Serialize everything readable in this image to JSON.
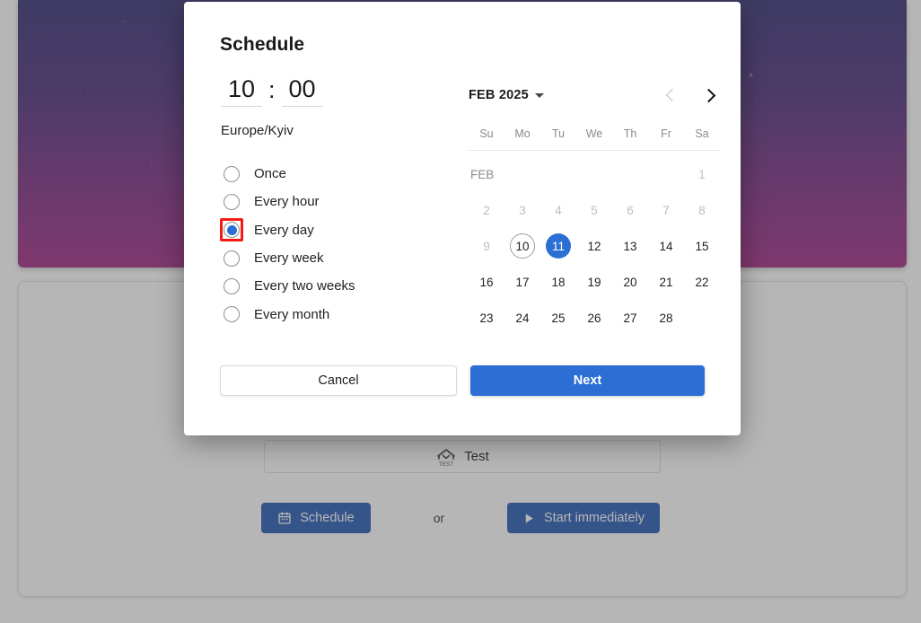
{
  "background": {
    "hero_banner": "starry-purple-gradient-banner",
    "test_strip": {
      "icon": "home-test-icon",
      "icon_caption": "TEST",
      "label": "Test"
    },
    "actions": {
      "schedule_label": "Schedule",
      "schedule_icon": "calendar-icon",
      "or_label": "or",
      "start_label": "Start immediately",
      "start_icon": "play-icon"
    }
  },
  "modal": {
    "title": "Schedule",
    "time": {
      "hours": "10",
      "separator": ":",
      "minutes": "00",
      "hours_placeholder": "HH",
      "minutes_placeholder": "MM"
    },
    "timezone": "Europe/Kyiv",
    "frequency": {
      "selected": "Every day",
      "highlighted": "Every day",
      "options": [
        {
          "label": "Once",
          "checked": false
        },
        {
          "label": "Every hour",
          "checked": false
        },
        {
          "label": "Every day",
          "checked": true
        },
        {
          "label": "Every week",
          "checked": false
        },
        {
          "label": "Every two weeks",
          "checked": false
        },
        {
          "label": "Every month",
          "checked": false
        }
      ]
    },
    "calendar": {
      "month_label": "FEB 2025",
      "month_short": "FEB",
      "prev_enabled": false,
      "next_enabled": true,
      "weekdays": [
        "Su",
        "Mo",
        "Tu",
        "We",
        "Th",
        "Fr",
        "Sa"
      ],
      "today": 10,
      "selected": 11,
      "disabled_days": [
        1,
        2,
        3,
        4,
        5,
        6,
        7,
        8,
        9
      ],
      "cells": [
        {
          "text": "FEB",
          "type": "month-label"
        },
        {
          "text": "",
          "type": "empty"
        },
        {
          "text": "",
          "type": "empty"
        },
        {
          "text": "",
          "type": "empty"
        },
        {
          "text": "",
          "type": "empty"
        },
        {
          "text": "",
          "type": "empty"
        },
        {
          "text": "1",
          "type": "disabled"
        },
        {
          "text": "2",
          "type": "disabled"
        },
        {
          "text": "3",
          "type": "disabled"
        },
        {
          "text": "4",
          "type": "disabled"
        },
        {
          "text": "5",
          "type": "disabled"
        },
        {
          "text": "6",
          "type": "disabled"
        },
        {
          "text": "7",
          "type": "disabled"
        },
        {
          "text": "8",
          "type": "disabled"
        },
        {
          "text": "9",
          "type": "disabled"
        },
        {
          "text": "10",
          "type": "today"
        },
        {
          "text": "11",
          "type": "selected"
        },
        {
          "text": "12",
          "type": "normal"
        },
        {
          "text": "13",
          "type": "normal"
        },
        {
          "text": "14",
          "type": "normal"
        },
        {
          "text": "15",
          "type": "normal"
        },
        {
          "text": "16",
          "type": "normal"
        },
        {
          "text": "17",
          "type": "normal"
        },
        {
          "text": "18",
          "type": "normal"
        },
        {
          "text": "19",
          "type": "normal"
        },
        {
          "text": "20",
          "type": "normal"
        },
        {
          "text": "21",
          "type": "normal"
        },
        {
          "text": "22",
          "type": "normal"
        },
        {
          "text": "23",
          "type": "normal"
        },
        {
          "text": "24",
          "type": "normal"
        },
        {
          "text": "25",
          "type": "normal"
        },
        {
          "text": "26",
          "type": "normal"
        },
        {
          "text": "27",
          "type": "normal"
        },
        {
          "text": "28",
          "type": "normal"
        },
        {
          "text": "",
          "type": "empty"
        }
      ]
    },
    "footer": {
      "cancel_label": "Cancel",
      "next_label": "Next"
    }
  },
  "colors": {
    "accent_blue": "#2b6fd4",
    "highlight_red": "#f51a13",
    "bg_button_blue": "#2256b3",
    "banner_start": "#312b72",
    "banner_end": "#a02683"
  }
}
